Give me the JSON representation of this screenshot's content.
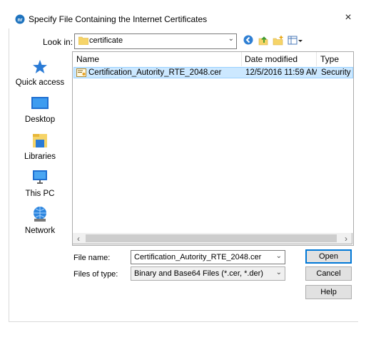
{
  "window": {
    "title": "Specify File Containing the Internet Certificates",
    "close_label": "×"
  },
  "lookin": {
    "label": "Look in:",
    "value": "certificate"
  },
  "toolbar": {
    "icons": [
      "back-icon",
      "up-folder-icon",
      "new-folder-icon",
      "view-menu-icon"
    ]
  },
  "places": [
    {
      "label": "Quick access",
      "icon": "quick-access-star-icon"
    },
    {
      "label": "Desktop",
      "icon": "desktop-icon"
    },
    {
      "label": "Libraries",
      "icon": "libraries-icon"
    },
    {
      "label": "This PC",
      "icon": "this-pc-icon"
    },
    {
      "label": "Network",
      "icon": "network-icon"
    }
  ],
  "columns": {
    "name": "Name",
    "date": "Date modified",
    "type": "Type"
  },
  "files": [
    {
      "name": "Certification_Autority_RTE_2048.cer",
      "date": "12/5/2016 11:59 AM",
      "type": "Security Certificate",
      "selected": true
    }
  ],
  "file_name": {
    "label": "File name:",
    "value": "Certification_Autority_RTE_2048.cer"
  },
  "file_type": {
    "label": "Files of type:",
    "value": "Binary and Base64 Files (*.cer, *.der)"
  },
  "buttons": {
    "open": "Open",
    "cancel": "Cancel",
    "help": "Help"
  },
  "colors": {
    "selection": "#cce8ff",
    "accent": "#0078d7"
  }
}
